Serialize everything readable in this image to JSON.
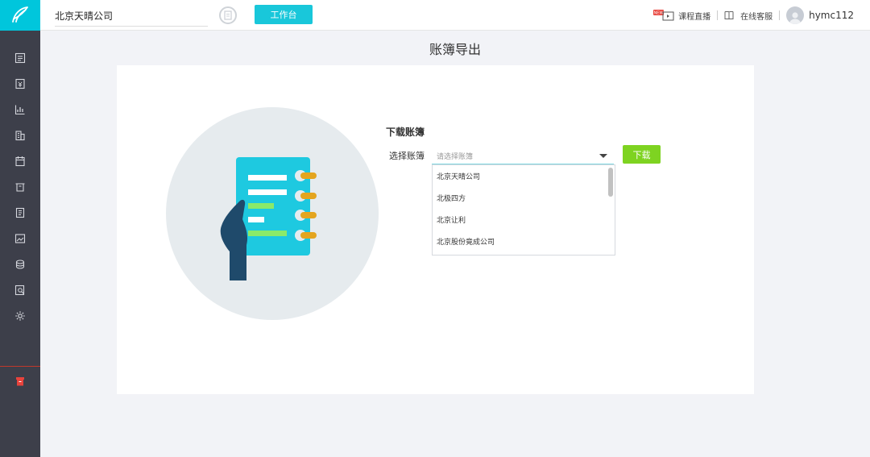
{
  "topbar": {
    "company": "北京天晴公司",
    "workbench_label": "工作台",
    "live_label": "课程直播",
    "live_badge": "NEW",
    "service_label": "在线客服",
    "username": "hymc112"
  },
  "sidebar": {
    "items": [
      "vouchers-icon",
      "ledger-icon",
      "chart-icon",
      "building-icon",
      "calendar-icon",
      "tray-icon",
      "report-icon",
      "image-icon",
      "coins-icon",
      "search-doc-icon",
      "gear-icon"
    ],
    "bottom_item": "trash-icon"
  },
  "page": {
    "title": "账簿导出",
    "section_title": "下载账簿",
    "field_label": "选择账簿",
    "select_placeholder": "请选择账簿",
    "download_label": "下载",
    "options": [
      "北京天晴公司",
      "北极四方",
      "北京让利",
      "北京股份竟成公司"
    ]
  },
  "colors": {
    "accent": "#19c7da",
    "download": "#7ed321",
    "sidebar": "#3d3f4a"
  }
}
